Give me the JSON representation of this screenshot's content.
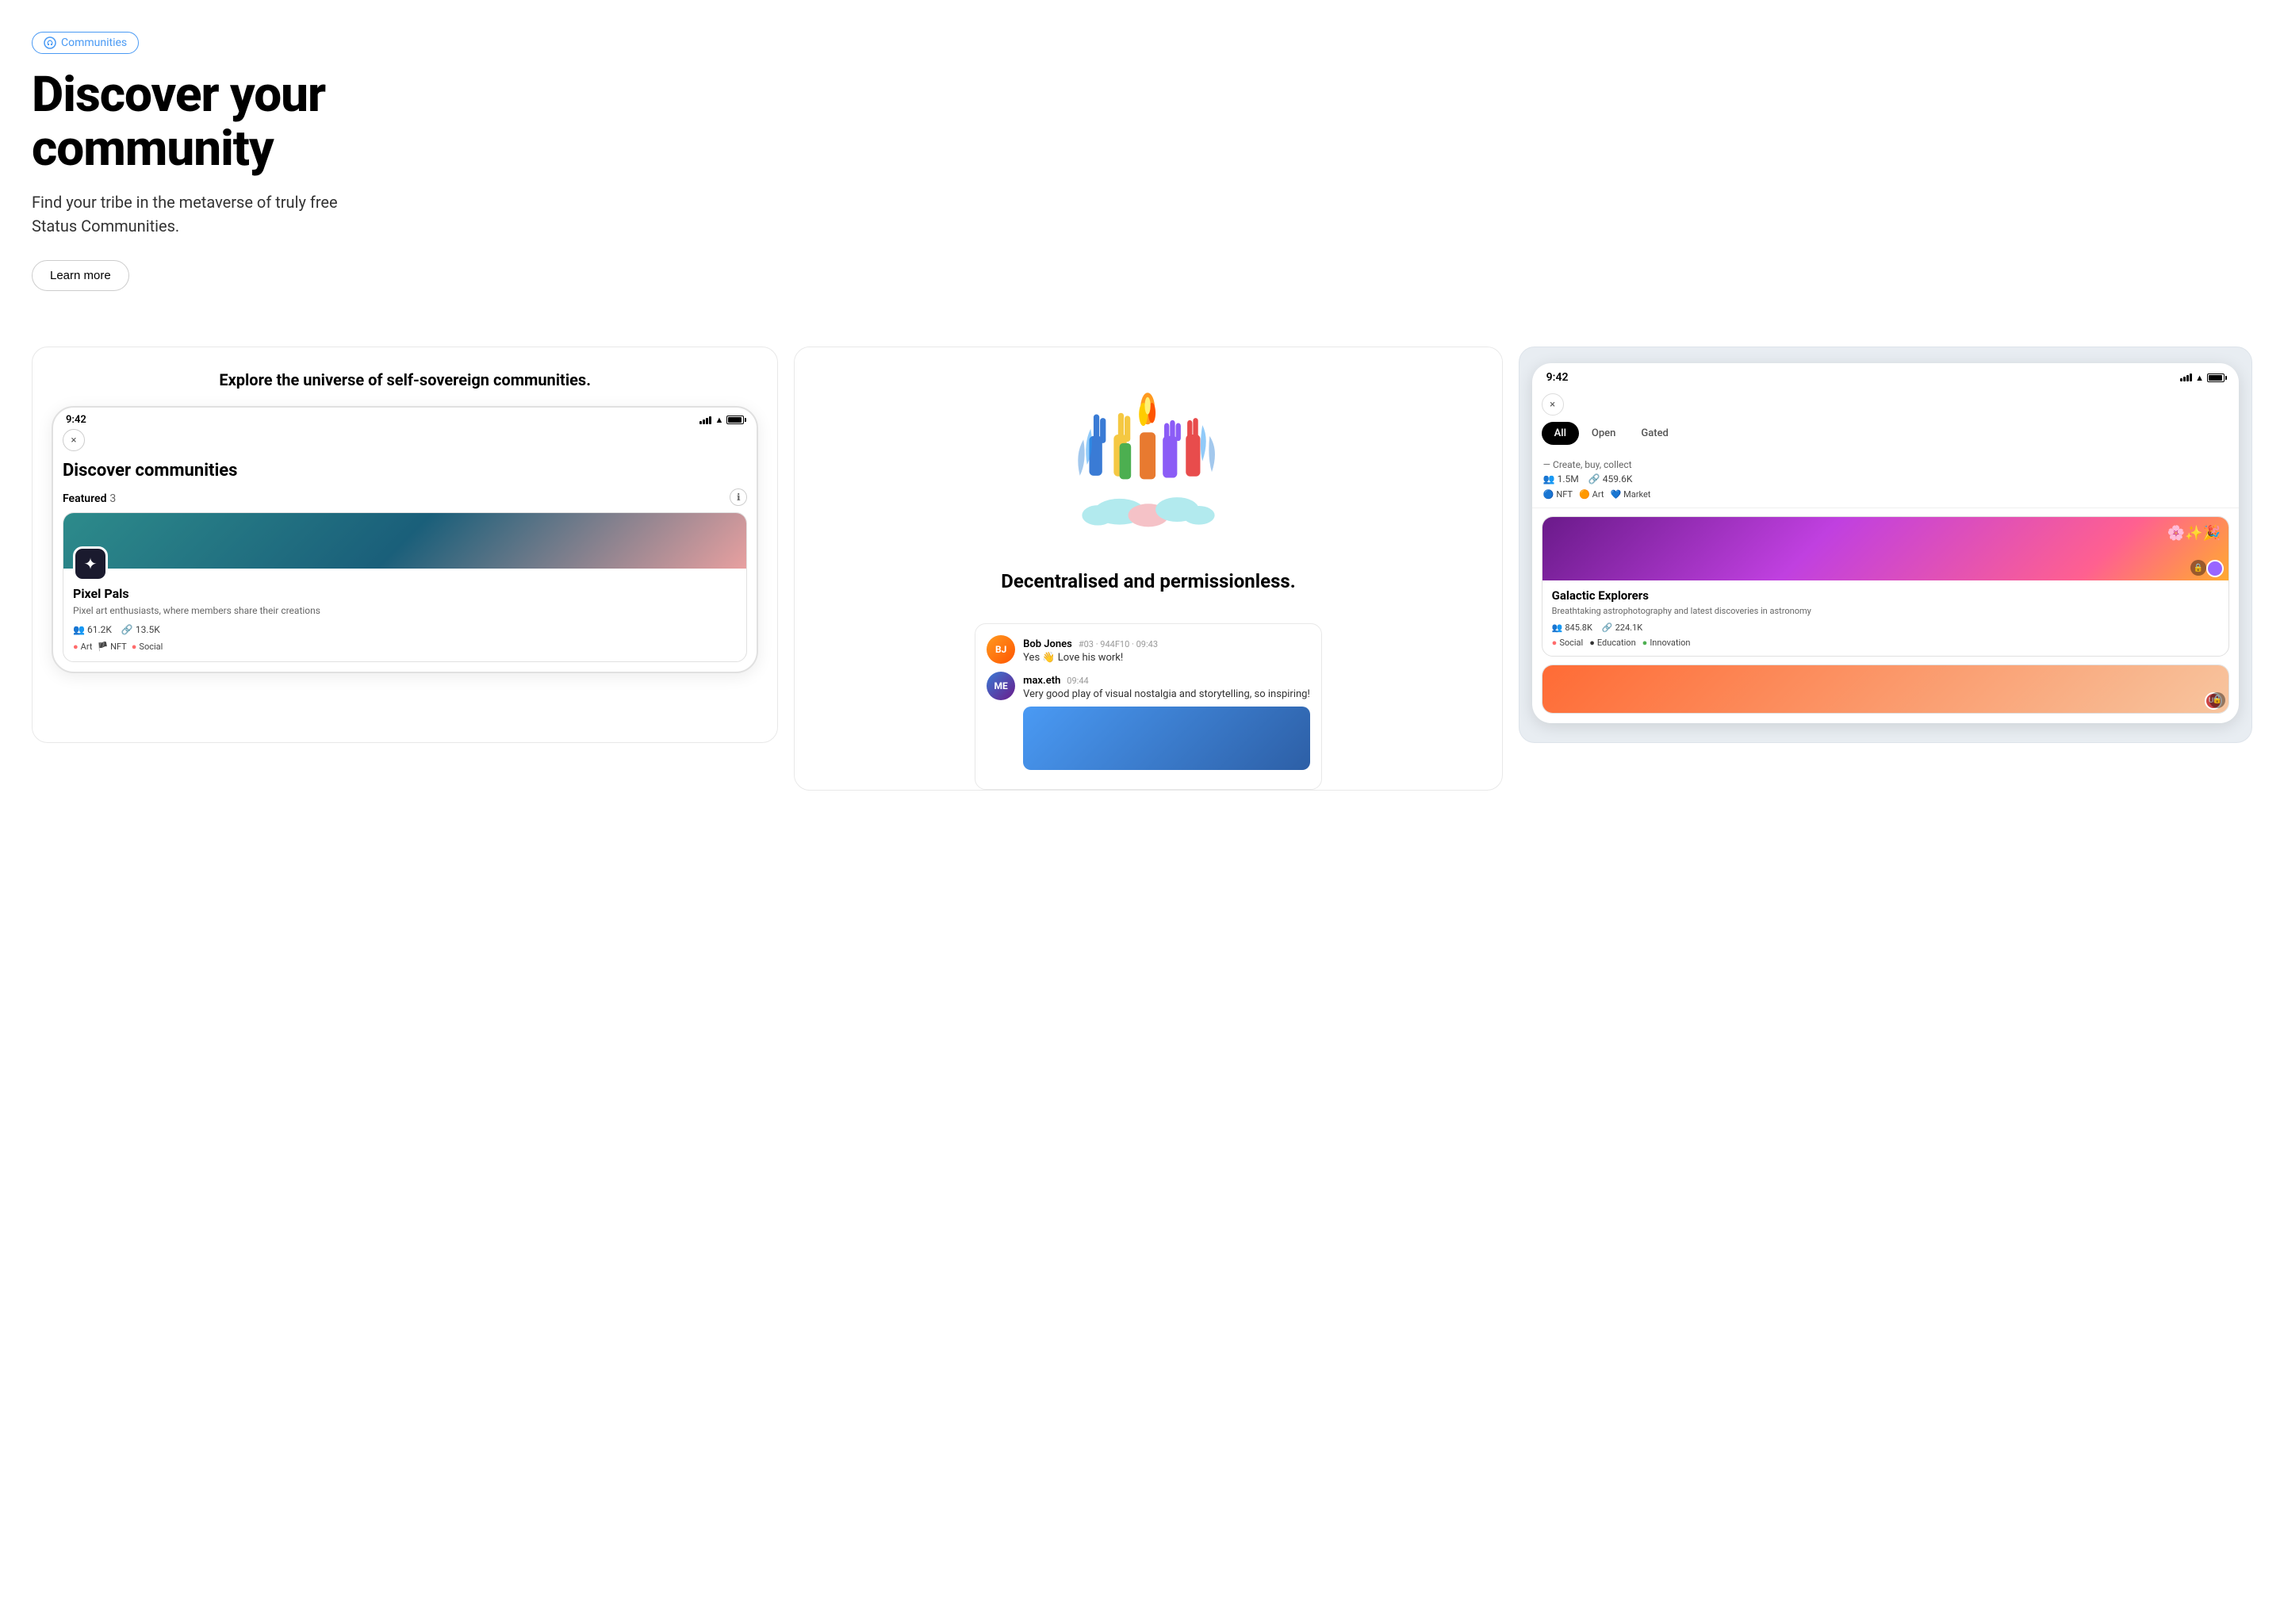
{
  "hero": {
    "badge_label": "Communities",
    "title_line1": "Discover your",
    "title_line2": "community",
    "subtitle": "Find your tribe in the metaverse of truly free Status Communities.",
    "learn_more": "Learn more"
  },
  "cards": {
    "left": {
      "title": "Explore the universe of self-sovereign communities.",
      "phone_time": "9:42",
      "close_label": "×",
      "discover_title": "Discover communities",
      "featured_label": "Featured",
      "featured_count": "3",
      "community_name": "Pixel Pals",
      "community_desc": "Pixel art enthusiasts, where members share their creations",
      "stat_members": "61.2K",
      "stat_tokens": "13.5K",
      "tags": [
        "Art",
        "NFT",
        "Social"
      ]
    },
    "middle": {
      "title": "Decentralised and permissionless.",
      "chat_user1": "Bob Jones",
      "chat_user1_meta": "#03 · 944F10 · 09:43",
      "chat_text1": "Yes 👋 Love his work!",
      "chat_user2": "max.eth",
      "chat_user2_meta": "09:44",
      "chat_text2": "Very good play of visual nostalgia and storytelling, so inspiring!"
    },
    "right": {
      "phone_time": "9:42",
      "close_label": "×",
      "filter_all": "All",
      "filter_open": "Open",
      "filter_gated": "Gated",
      "community_tagline": "— Create, buy, collect",
      "stat1": "1.5M",
      "stat2": "459.6K",
      "tag_nft": "NFT",
      "tag_art": "Art",
      "tag_market": "Market",
      "galactic_name": "Galactic Explorers",
      "galactic_desc": "Breathtaking astrophotography and latest discoveries in astronomy",
      "galactic_stat1": "845.8K",
      "galactic_stat2": "224.1K",
      "galactic_tag1": "Social",
      "galactic_tag2": "Education",
      "galactic_tag3": "Innovation"
    }
  },
  "colors": {
    "badge_border": "#4a9af4",
    "badge_text": "#4a9af4",
    "btn_border": "#cccccc",
    "card_border": "#e8e8e8",
    "card_right_bg": "#e8edf2",
    "tag_art_dot": "#ff6b6b",
    "tag_nft_dot": "#4a9af4",
    "tag_social_dot": "#ff6b6b",
    "active_tab_bg": "#000000",
    "active_tab_text": "#ffffff"
  }
}
